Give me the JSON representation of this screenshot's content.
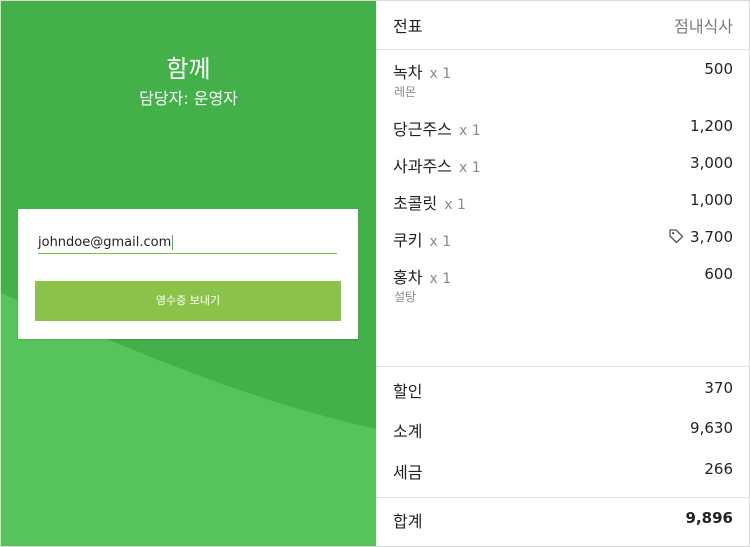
{
  "left_panel": {
    "shop_name": "함께",
    "staff_line": "담당자: 운영자",
    "email_value": "johndoe@gmail.com",
    "send_button_label": "영수증 보내기",
    "colors": {
      "background": "#44b04a",
      "wave_light": "#5ac85e",
      "button": "#8bc34a"
    }
  },
  "receipt": {
    "title": "전표",
    "order_type": "점내식사",
    "items": [
      {
        "name": "녹차",
        "qty": "x 1",
        "price": "500",
        "note": "레몬",
        "icon": ""
      },
      {
        "name": "당근주스",
        "qty": "x 1",
        "price": "1,200",
        "note": "",
        "icon": ""
      },
      {
        "name": "사과주스",
        "qty": "x 1",
        "price": "3,000",
        "note": "",
        "icon": ""
      },
      {
        "name": "초콜릿",
        "qty": "x 1",
        "price": "1,000",
        "note": "",
        "icon": ""
      },
      {
        "name": "쿠키",
        "qty": "x 1",
        "price": "3,700",
        "note": "",
        "icon": "tag-icon"
      },
      {
        "name": "홍차",
        "qty": "x 1",
        "price": "600",
        "note": "설탕",
        "icon": ""
      }
    ],
    "summary": {
      "discount_label": "할인",
      "discount_value": "370",
      "subtotal_label": "소계",
      "subtotal_value": "9,630",
      "tax_label": "세금",
      "tax_value": "266",
      "total_label": "합계",
      "total_value": "9,896"
    }
  }
}
